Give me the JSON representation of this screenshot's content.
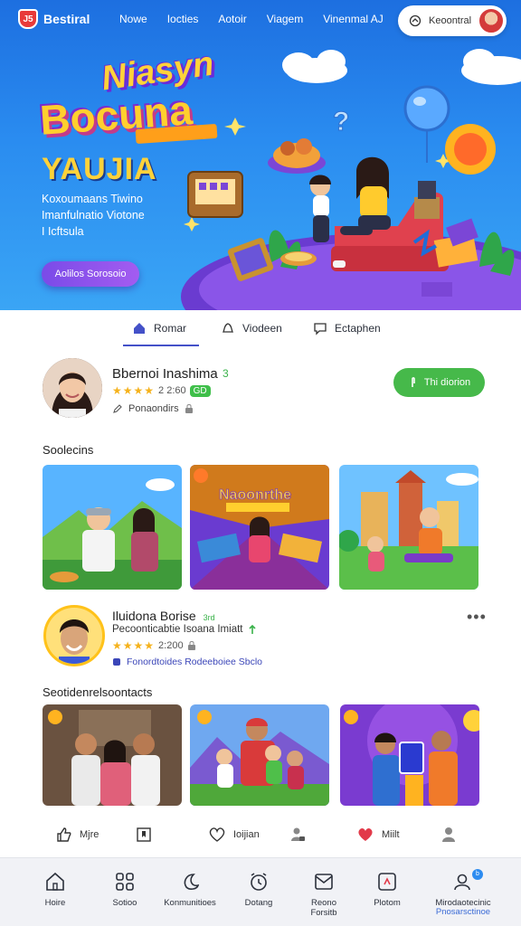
{
  "app": {
    "logo_text": "Bestiral",
    "logo_badge": "J5"
  },
  "nav": {
    "links": [
      "Nowe",
      "Iocties",
      "Aotoir",
      "Viagem",
      "Vinenmal AJ"
    ],
    "pill_label": "Keoontral"
  },
  "hero": {
    "title_line1": "Niasyn",
    "title_line2": "Bocuna",
    "title_line3": "YAUJIA",
    "description": [
      "Koxoumaans Tiwino",
      "Imanfulnatio Viotone",
      "I Icftsula"
    ],
    "cta_label": "Aolilos Sorosoio"
  },
  "tabs": [
    {
      "label": "Romar",
      "icon": "home-icon",
      "active": true
    },
    {
      "label": "Viodeen",
      "icon": "bell-icon",
      "active": false
    },
    {
      "label": "Ectaphen",
      "icon": "chat-icon",
      "active": false
    }
  ],
  "profile1": {
    "name": "Bbernoi Inashima",
    "name_suffix": "3",
    "stars": "★★★★",
    "rating_text": "2 2:60",
    "tag": "GD",
    "meta": "Ponaondirs",
    "follow_label": "Thi diorion"
  },
  "section1": {
    "title": "Soolecins"
  },
  "profile2": {
    "name": "Iluidona Borise",
    "name_suffix": "3rd",
    "subtitle": "Pecoonticabtie Isoana Imiatt",
    "stars": "★★★★",
    "rating_text": "2:200",
    "meta": "Fonordtoides  Rodeeboiee Sbclo"
  },
  "section2": {
    "title": "Seotidenrelsoontacts"
  },
  "actions": [
    {
      "icon": "thumbs-up-icon",
      "label": "Mjre"
    },
    {
      "icon": "bookmark-icon",
      "label": ""
    },
    {
      "icon": "heart-outline-icon",
      "label": "Ioijian"
    },
    {
      "icon": "user-lock-icon",
      "label": ""
    },
    {
      "icon": "heart-filled-icon",
      "label": "Miilt"
    },
    {
      "icon": "person-icon",
      "label": ""
    }
  ],
  "bottom_nav": [
    {
      "icon": "home-icon",
      "label": "Hoire",
      "sub": ""
    },
    {
      "icon": "grid-icon",
      "label": "Sotioo",
      "sub": ""
    },
    {
      "icon": "moon-icon",
      "label": "Konmunitioes",
      "sub": ""
    },
    {
      "icon": "alarm-icon",
      "label": "Dotang",
      "sub": ""
    },
    {
      "icon": "mail-icon",
      "label": "Reono",
      "sub": "Forsitb"
    },
    {
      "icon": "calendar-icon",
      "label": "Plotom",
      "sub": ""
    },
    {
      "icon": "profile-icon",
      "label": "Mirodaotecinic",
      "sub": "Pnosarsctinoe"
    }
  ],
  "colors": {
    "primary": "#4451c8",
    "hero_top": "#1d6fe0",
    "accent_green": "#46b94a",
    "cta_purple": "#8a51ec",
    "star": "#f5b21c"
  }
}
